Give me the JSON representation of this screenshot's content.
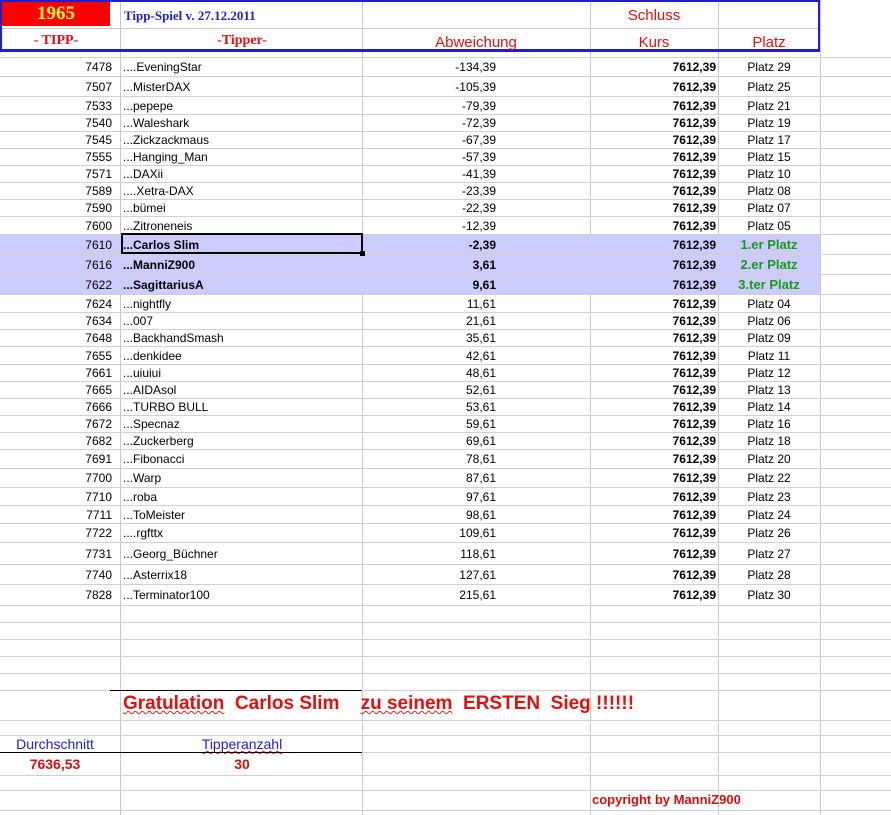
{
  "header": {
    "year": "1965",
    "title": "Tipp-Spiel v. 27.12.2011",
    "schluss": "Schluss",
    "col_tipp": "- TIPP-",
    "col_tipper": "-Tipper-",
    "col_abweichung": "Abweichung",
    "col_kurs": "Kurs",
    "col_platz": "Platz"
  },
  "colors": {
    "year_bg": "#ff0000",
    "year_text": "#ffff33",
    "header_blue": "#1f1fcc",
    "header_red": "#e01010",
    "highlight": "#ccccff",
    "winner_green": "#1a9a1a"
  },
  "rows": [
    {
      "tipp": "7478",
      "tipper": "....EveningStar",
      "abw": "-134,39",
      "kurs": "7612,39",
      "platz": "Platz 29"
    },
    {
      "tipp": "7507",
      "tipper": "...MisterDAX",
      "abw": "-105,39",
      "kurs": "7612,39",
      "platz": "Platz 25"
    },
    {
      "tipp": "7533",
      "tipper": "...pepepe",
      "abw": "-79,39",
      "kurs": "7612,39",
      "platz": "Platz 21"
    },
    {
      "tipp": "7540",
      "tipper": "...Waleshark",
      "abw": "-72,39",
      "kurs": "7612,39",
      "platz": "Platz 19"
    },
    {
      "tipp": "7545",
      "tipper": "...Zickzackmaus",
      "abw": "-67,39",
      "kurs": "7612,39",
      "platz": "Platz 17"
    },
    {
      "tipp": "7555",
      "tipper": "...Hanging_Man",
      "abw": "-57,39",
      "kurs": "7612,39",
      "platz": "Platz 15"
    },
    {
      "tipp": "7571",
      "tipper": "...DAXii",
      "abw": "-41,39",
      "kurs": "7612,39",
      "platz": "Platz 10"
    },
    {
      "tipp": "7589",
      "tipper": "....Xetra-DAX",
      "abw": "-23,39",
      "kurs": "7612,39",
      "platz": "Platz 08"
    },
    {
      "tipp": "7590",
      "tipper": "...bümei",
      "abw": "-22,39",
      "kurs": "7612,39",
      "platz": "Platz 07"
    },
    {
      "tipp": "7600",
      "tipper": "...Zitroneneis",
      "abw": "-12,39",
      "kurs": "7612,39",
      "platz": "Platz 05"
    },
    {
      "tipp": "7610",
      "tipper": "...Carlos Slim",
      "abw": "-2,39",
      "kurs": "7612,39",
      "platz": "1.er Platz",
      "hl": true
    },
    {
      "tipp": "7616",
      "tipper": "...ManniZ900",
      "abw": "3,61",
      "kurs": "7612,39",
      "platz": "2.er Platz",
      "hl": true
    },
    {
      "tipp": "7622",
      "tipper": "...SagittariusA",
      "abw": "9,61",
      "kurs": "7612,39",
      "platz": "3.ter Platz",
      "hl": true
    },
    {
      "tipp": "7624",
      "tipper": "...nightfly",
      "abw": "11,61",
      "kurs": "7612,39",
      "platz": "Platz 04"
    },
    {
      "tipp": "7634",
      "tipper": "...007",
      "abw": "21,61",
      "kurs": "7612,39",
      "platz": "Platz 06"
    },
    {
      "tipp": "7648",
      "tipper": "...BackhandSmash",
      "abw": "35,61",
      "kurs": "7612,39",
      "platz": "Platz 09"
    },
    {
      "tipp": "7655",
      "tipper": "...denkidee",
      "abw": "42,61",
      "kurs": "7612,39",
      "platz": "Platz 11"
    },
    {
      "tipp": "7661",
      "tipper": "...uiuiui",
      "abw": "48,61",
      "kurs": "7612,39",
      "platz": "Platz 12"
    },
    {
      "tipp": "7665",
      "tipper": "...AIDAsol",
      "abw": "52,61",
      "kurs": "7612,39",
      "platz": "Platz 13"
    },
    {
      "tipp": "7666",
      "tipper": "...TURBO BULL",
      "abw": "53,61",
      "kurs": "7612,39",
      "platz": "Platz 14"
    },
    {
      "tipp": "7672",
      "tipper": "...Specnaz",
      "abw": "59,61",
      "kurs": "7612,39",
      "platz": "Platz 16"
    },
    {
      "tipp": "7682",
      "tipper": "...Zuckerberg",
      "abw": "69,61",
      "kurs": "7612,39",
      "platz": "Platz 18"
    },
    {
      "tipp": "7691",
      "tipper": "...Fibonacci",
      "abw": "78,61",
      "kurs": "7612,39",
      "platz": "Platz 20"
    },
    {
      "tipp": "7700",
      "tipper": "...Warp",
      "abw": "87,61",
      "kurs": "7612,39",
      "platz": "Platz 22"
    },
    {
      "tipp": "7710",
      "tipper": "...roba",
      "abw": "97,61",
      "kurs": "7612,39",
      "platz": "Platz 23"
    },
    {
      "tipp": "7711",
      "tipper": "...ToMeister",
      "abw": "98,61",
      "kurs": "7612,39",
      "platz": "Platz 24"
    },
    {
      "tipp": "7722",
      "tipper": "....rgfttx",
      "abw": "109,61",
      "kurs": "7612,39",
      "platz": "Platz 26"
    },
    {
      "tipp": "7731",
      "tipper": "...Georg_Büchner",
      "abw": "118,61",
      "kurs": "7612,39",
      "platz": "Platz 27"
    },
    {
      "tipp": "7740",
      "tipper": "...Asterrix18",
      "abw": "127,61",
      "kurs": "7612,39",
      "platz": "Platz 28"
    },
    {
      "tipp": "7828",
      "tipper": "...Terminator100",
      "abw": "215,61",
      "kurs": "7612,39",
      "platz": "Platz 30"
    }
  ],
  "footer": {
    "gratulation": "Gratulation",
    "winner": "Carlos Slim",
    "zu_seinem": "zu seinem",
    "ersten": "ERSTEN",
    "sieg": "Sieg !!!!!!",
    "durchschnitt_label": "Durchschnitt",
    "durchschnitt_value": "7636,53",
    "tipperanzahl_label": "Tipperanzahl",
    "tipperanzahl_value": "30",
    "copyright": "copyright by ManniZ900"
  }
}
